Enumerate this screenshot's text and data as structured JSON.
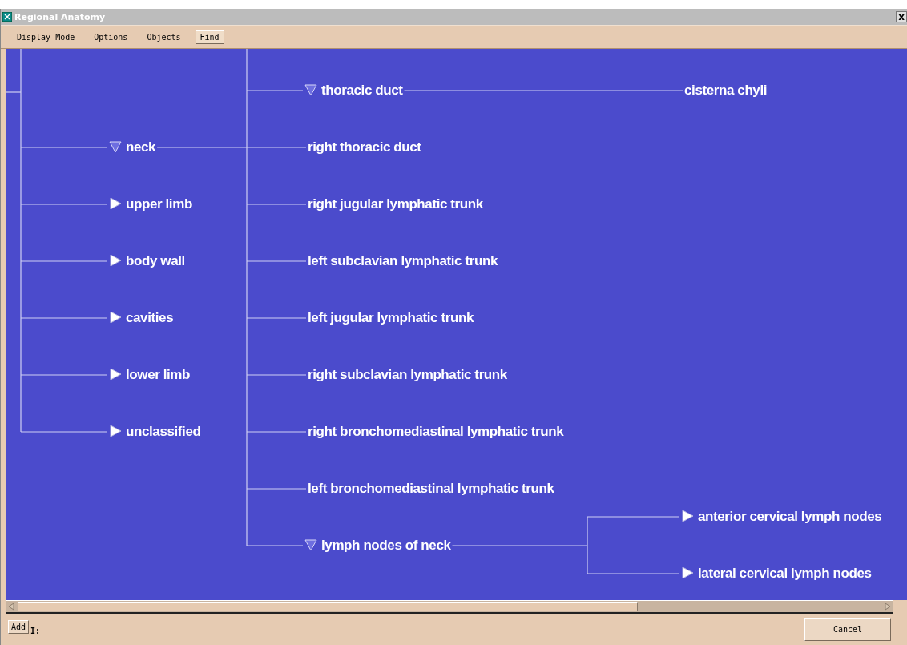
{
  "window": {
    "title": "Regional Anatomy",
    "close": "x"
  },
  "menu": [
    {
      "label": "Display Mode",
      "selected": false
    },
    {
      "label": "Options",
      "selected": false
    },
    {
      "label": "Objects",
      "selected": false
    },
    {
      "label": "Find",
      "selected": true
    }
  ],
  "tree": {
    "items": [
      {
        "label": "neck",
        "expanded": true,
        "children": [
          {
            "label": "thoracic duct",
            "expanded": true,
            "children": [
              {
                "label": "cisterna chyli"
              }
            ]
          },
          {
            "label": "right thoracic duct"
          },
          {
            "label": "right jugular lymphatic trunk"
          },
          {
            "label": "left subclavian lymphatic trunk"
          },
          {
            "label": "left jugular lymphatic trunk"
          },
          {
            "label": "right subclavian lymphatic trunk"
          },
          {
            "label": "right bronchomediastinal lymphatic trunk"
          },
          {
            "label": "left bronchomediastinal lymphatic trunk"
          },
          {
            "label": "lymph nodes of neck",
            "expanded": true,
            "children": [
              {
                "label": "anterior cervical lymph nodes",
                "expanded": false
              },
              {
                "label": "lateral cervical lymph nodes",
                "expanded": false
              }
            ]
          }
        ]
      },
      {
        "label": "upper limb",
        "expanded": false
      },
      {
        "label": "body wall",
        "expanded": false
      },
      {
        "label": "cavities",
        "expanded": false
      },
      {
        "label": "lower limb",
        "expanded": false
      },
      {
        "label": "unclassified",
        "expanded": false
      }
    ]
  },
  "bottom": {
    "add_button": "Add",
    "field_label": "I:",
    "cancel_button": "Cancel"
  }
}
